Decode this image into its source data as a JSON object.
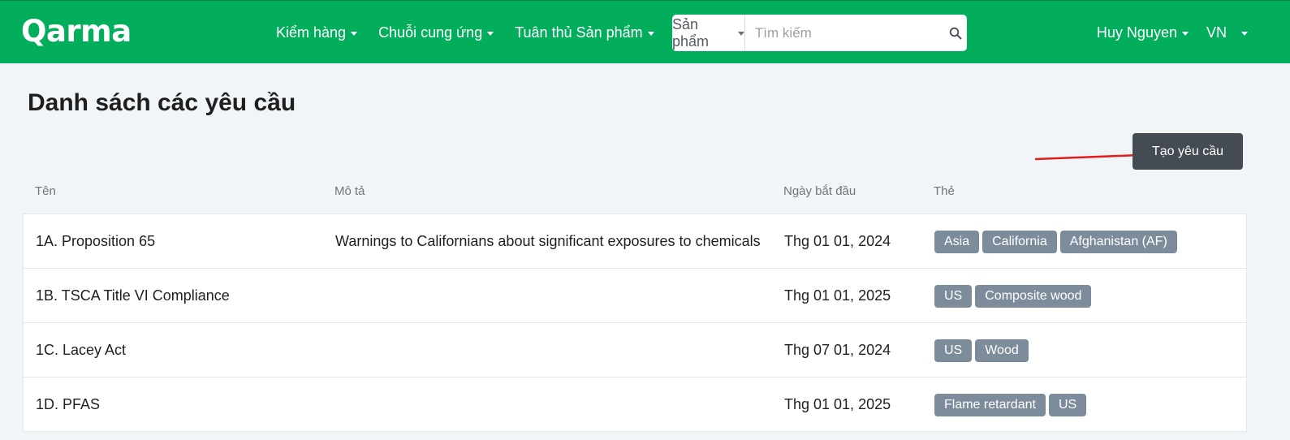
{
  "brand": {
    "logo_text": "Qarma"
  },
  "nav": {
    "items": [
      {
        "label": "Kiểm hàng"
      },
      {
        "label": "Chuỗi cung ứng"
      },
      {
        "label": "Tuân thủ Sản phẩm"
      }
    ],
    "user_name": "Huy Nguyen",
    "language": "VN"
  },
  "search": {
    "scope_label": "Sản phẩm",
    "placeholder": "Tìm kiếm",
    "value": ""
  },
  "page": {
    "title": "Danh sách các yêu cầu",
    "create_button_label": "Tạo yêu cầu"
  },
  "table": {
    "columns": {
      "name": "Tên",
      "description": "Mô tả",
      "start_date": "Ngày bắt đầu",
      "tags": "Thẻ"
    },
    "rows": [
      {
        "name": "1A. Proposition 65",
        "description": "Warnings to Californians about significant exposures to chemicals",
        "start_date": "Thg 01 01, 2024",
        "tags": [
          "Asia",
          "California",
          "Afghanistan (AF)"
        ]
      },
      {
        "name": "1B. TSCA Title VI Compliance",
        "description": "",
        "start_date": "Thg 01 01, 2025",
        "tags": [
          "US",
          "Composite wood"
        ]
      },
      {
        "name": "1C. Lacey Act",
        "description": "",
        "start_date": "Thg 07 01, 2024",
        "tags": [
          "US",
          "Wood"
        ]
      },
      {
        "name": "1D. PFAS",
        "description": "",
        "start_date": "Thg 01 01, 2025",
        "tags": [
          "Flame retardant",
          "US"
        ]
      }
    ]
  },
  "colors": {
    "navbar": "#02ae5c",
    "create_button": "#454b53",
    "tag": "#7d8c9b",
    "annotation_arrow": "#e31b1b"
  },
  "icons": {
    "search": "search-icon",
    "dropdown": "chevron-down-icon",
    "annotation": "red-arrow-icon"
  }
}
